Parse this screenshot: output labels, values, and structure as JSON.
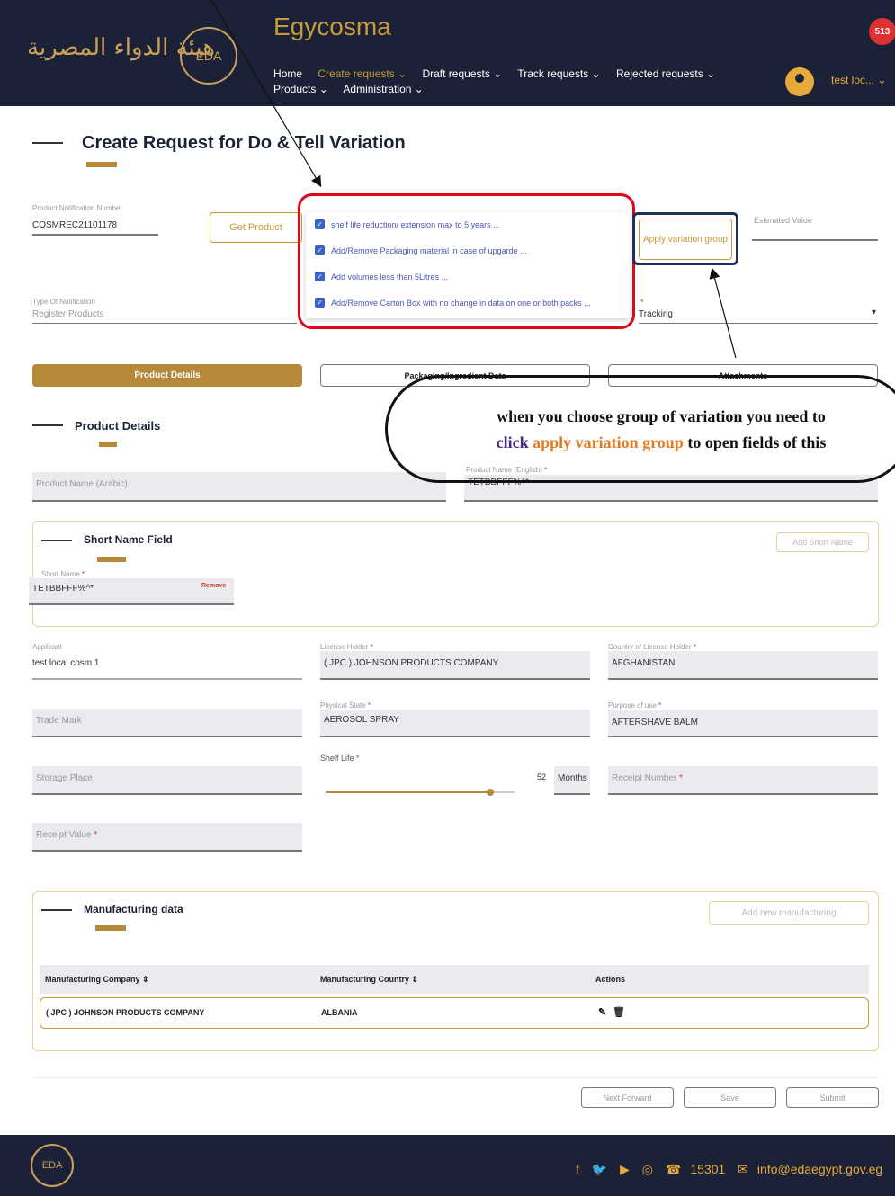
{
  "header": {
    "logo_arabic": "هيئة الدواء المصرية",
    "emblem_text": "EDA",
    "brand": "Egycosma",
    "nav": [
      {
        "label": "Home"
      },
      {
        "label": "Create requests ⌄"
      },
      {
        "label": "Draft requests ⌄"
      },
      {
        "label": "Track requests ⌄"
      },
      {
        "label": "Rejected requests ⌄"
      },
      {
        "label": "Products ⌄"
      },
      {
        "label": "Administration ⌄"
      }
    ],
    "notification_count": "513",
    "user_name": "test loc... ⌄"
  },
  "page": {
    "title": "Create Request for Do & Tell Variation"
  },
  "top_form": {
    "notification_label": "Product Notification Number",
    "notification_value": "COSMREC21101178",
    "get_product": "Get Product",
    "apply_variation_group": "Apply variation group",
    "estimated_label": "Estimated Value",
    "type_label": "Type Of Notification",
    "type_value": "Register Products",
    "tracking_value": "Tracking",
    "variations": [
      {
        "label": "shelf life reduction/ extension max to 5 years ..."
      },
      {
        "label": "Add/Remove Packaging material in case of upgarde ..."
      },
      {
        "label": "Add volumes less than 5Litres ..."
      },
      {
        "label": "Add/Remove Carton Box with no change in data on one or both packs ..."
      }
    ]
  },
  "tabs": {
    "product_details": "Product Details",
    "packaging": "Packaging/Ingredient Data",
    "attachments": "Attachments"
  },
  "callout": {
    "part1": "when you choose group of variation you need to",
    "part2": "click",
    "part3": "apply variation group",
    "part4": "to open fields of this"
  },
  "product_details": {
    "title": "Product Details",
    "name_ar_label": "Product Name (Arabic)",
    "name_en_label": "Product Name (English)",
    "name_en_value": "TETBBFFF%^*",
    "short_name_title": "Short Name Field",
    "add_short_name": "Add Short Name",
    "short_name_label": "Short Name",
    "short_name_value": "TETBBFFF%^*",
    "remove": "Remove",
    "applicant_label": "Applicant",
    "applicant_value": "test local cosm 1",
    "license_holder_label": "License Holder",
    "license_holder_value": "( JPC ) JOHNSON PRODUCTS COMPANY",
    "country_label": "Country of License Holder",
    "country_value": "AFGHANISTAN",
    "trade_mark_label": "Trade Mark",
    "physical_state_label": "Physical State",
    "physical_state_value": "AEROSOL SPRAY",
    "purpose_label": "Purpose of use",
    "purpose_value": "AFTERSHAVE BALM",
    "storage_label": "Storage Place",
    "shelf_life_label": "Shelf Life",
    "shelf_life_value": "52",
    "shelf_life_unit": "Months",
    "shelf_life_fraction": 0.87,
    "receipt_number_label": "Receipt Number",
    "receipt_value_label": "Receipt Value"
  },
  "manufacturing": {
    "title": "Manufacturing data",
    "add_button": "Add new manufacturing",
    "columns": [
      "Manufacturing Company ⇕",
      "Manufacturing Country ⇕",
      "Actions"
    ],
    "rows": [
      {
        "company": "( JPC ) JOHNSON PRODUCTS COMPANY",
        "country": "ALBANIA"
      }
    ]
  },
  "actions": {
    "next": "Next Forward",
    "save": "Save",
    "submit": "Submit"
  },
  "footer": {
    "phone": "15301",
    "email": "info@edaegypt.gov.eg"
  },
  "colors": {
    "navy": "#1b2136",
    "gold": "#b6893a",
    "highlight_red": "#e0061b",
    "highlight_navy": "#1e2f5b"
  }
}
